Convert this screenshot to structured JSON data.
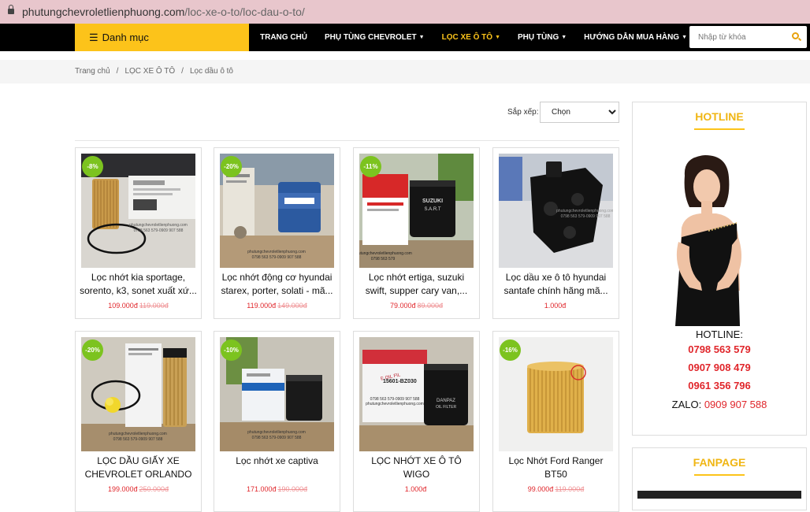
{
  "browser": {
    "url_domain": "phutungchevroletlienphuong.com",
    "url_path": "/loc-xe-o-to/loc-dau-o-to/"
  },
  "nav": {
    "danhmuc_label": "Danh mục",
    "menu": [
      {
        "label": "TRANG CHỦ",
        "has_dropdown": false
      },
      {
        "label": "PHỤ TÙNG CHEVROLET",
        "has_dropdown": true
      },
      {
        "label": "LỌC XE Ô TÔ",
        "has_dropdown": true,
        "active": true
      },
      {
        "label": "PHỤ TÙNG",
        "has_dropdown": true
      },
      {
        "label": "HƯỚNG DẪN MUA HÀNG",
        "has_dropdown": true
      }
    ],
    "search_placeholder": "Nhập từ khóa",
    "accent_color": "#fcc31a"
  },
  "breadcrumb": [
    "Trang chủ",
    "LỌC XE Ô TÔ",
    "Lọc dầu ô tô"
  ],
  "sort": {
    "label": "Sắp xếp:",
    "selected": "Chọn"
  },
  "products": [
    {
      "badge": "-8%",
      "name": "Lọc nhớt kia sportage, sorento, k3, sonet xuất xứ...",
      "price": "109.000đ",
      "old_price": "119.000đ"
    },
    {
      "badge": "-20%",
      "name": "Lọc nhớt động cơ hyundai starex, porter, solati - mã...",
      "price": "119.000đ",
      "old_price": "149.000đ"
    },
    {
      "badge": "-11%",
      "name": "Lọc nhớt ertiga, suzuki swift, supper cary van,...",
      "price": "79.000đ",
      "old_price": "89.000đ"
    },
    {
      "badge": "",
      "name": "Lọc dầu xe ô tô hyundai santafe chính hãng mã...",
      "price": "1.000đ",
      "old_price": ""
    },
    {
      "badge": "-20%",
      "name": "LỌC DẦU GIẤY XE CHEVROLET ORLANDO",
      "price": "199.000đ",
      "old_price": "250.000đ"
    },
    {
      "badge": "-10%",
      "name": "Lọc nhớt xe captiva",
      "price": "171.000đ",
      "old_price": "190.000đ"
    },
    {
      "badge": "",
      "name": "LỌC NHỚT XE Ô TÔ WIGO",
      "price": "1.000đ",
      "old_price": ""
    },
    {
      "badge": "-16%",
      "name": "Lọc Nhớt Ford Ranger BT50",
      "price": "99.000đ",
      "old_price": "119.000đ"
    }
  ],
  "image_texts": {
    "watermark": "phutungchevroletlienphuong.com",
    "watermark_phone": "0798 563 579-0909 907 588",
    "watermark_phone_short": "0798 563 579",
    "brand_suzuki": "SUZUKI",
    "brand_sart": "S.A.R.T",
    "part_number": "15601-BZ030",
    "brand_danpaz": "DANPAZ",
    "oil_filter": "OIL FILTER",
    "label_text": "E OIL FIL"
  },
  "sidebar": {
    "hotline_title": "HOTLINE",
    "hotline_label": "HOTLINE:",
    "phones": [
      "0798 563 579",
      "0907 908 479",
      "0961 356 796"
    ],
    "zalo_label": "ZALO:",
    "zalo_number": "0909 907 588",
    "fanpage_title": "FANPAGE"
  }
}
